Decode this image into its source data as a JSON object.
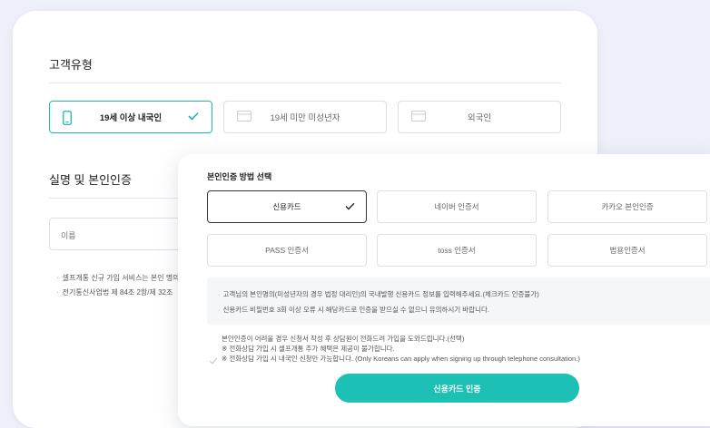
{
  "customer_type": {
    "title": "고객유형",
    "options": [
      {
        "label": "19세 이상 내국인",
        "selected": true,
        "icon": "phone-icon"
      },
      {
        "label": "19세 미만 미성년자",
        "selected": false,
        "icon": "card-icon"
      },
      {
        "label": "외국인",
        "selected": false,
        "icon": "card-icon"
      }
    ]
  },
  "verification": {
    "title": "실명 및 본인인증",
    "name_placeholder": "이름",
    "notes": [
      "셀프개통 신규 가입 서비스는 본인 명의",
      "전기통신사업법 제 84조 2항/제 32조"
    ]
  },
  "modal": {
    "title": "본인인증 방법 선택",
    "methods": [
      {
        "label": "신용카드",
        "selected": true
      },
      {
        "label": "네이버 인증서",
        "selected": false
      },
      {
        "label": "카카오 본인인증",
        "selected": false
      },
      {
        "label": "PASS 인증서",
        "selected": false
      },
      {
        "label": "toss 인증서",
        "selected": false
      },
      {
        "label": "범용인증서",
        "selected": false
      }
    ],
    "info": [
      "고객님의 본인명의(미성년자의 경우 법정 대리인)의 국내발행 신용카드 정보를 입력해주세요.(체크카드 인증불가)",
      "신용카드 비밀번호 3회 이상 오류 시 해당카드로 인증을 받으실 수 없으니 유의하시기 바랍니다."
    ],
    "consent": [
      "본인인증이 어려울 경우 신청서 작성 후 상담원이 전화드려 가입을 도와드립니다.(선택)",
      "※ 전화상담 가입 시 셀프개통 추가 혜택은 제공이 불가합니다.",
      "※ 전화상담 가입 시 내국인 신청만 가능합니다. (Only Koreans can apply when signing up through telephone consultation.)"
    ],
    "submit_label": "신용카드 인증"
  },
  "colors": {
    "accent": "#1cc0b4",
    "selected_border": "#19b9b2",
    "background": "#eef0f9"
  }
}
